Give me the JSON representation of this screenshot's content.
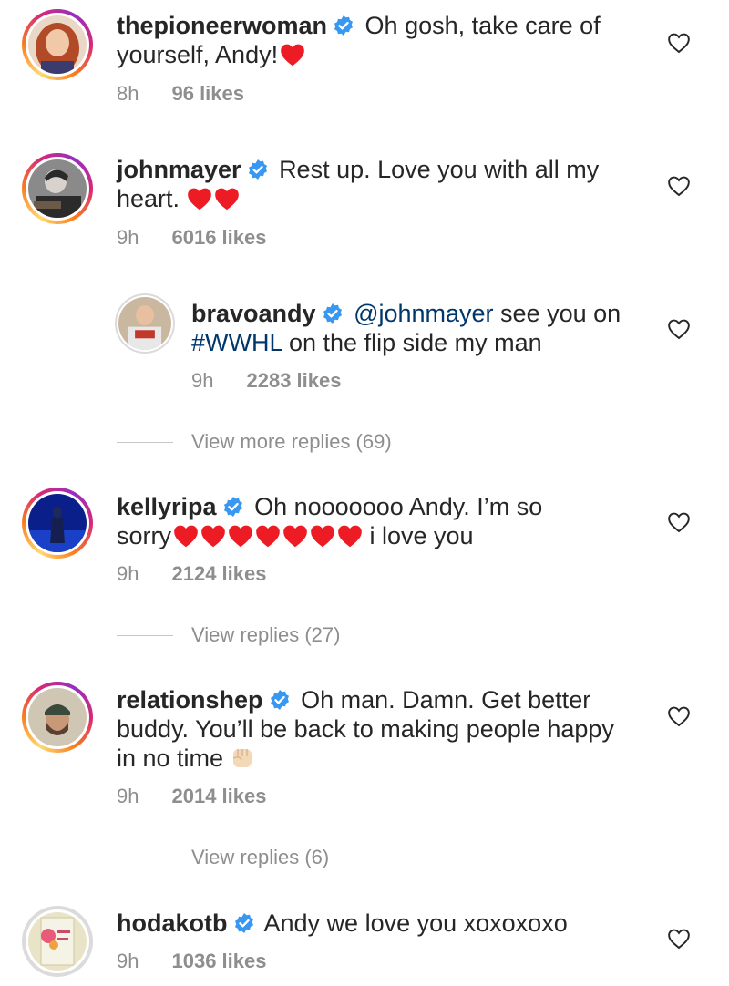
{
  "colors": {
    "verified": "#3897f0",
    "heart": "#ed1c24",
    "muted": "#8e8e8e",
    "mention": "#00376b"
  },
  "comments": [
    {
      "username": "thepioneerwoman",
      "line1": "Oh gosh, take care of",
      "line2": "yourself, Andy!",
      "time": "8h",
      "likes": "96 likes"
    },
    {
      "username": "johnmayer",
      "line1": "Rest up. Love you with all my",
      "line2": "heart.",
      "time": "9h",
      "likes": "6016 likes"
    },
    {
      "username": "bravoandy",
      "mention": "@johnmayer",
      "line1": " see you on",
      "line2_tag": "#WWHL",
      "line2": " on the flip side my man",
      "time": "9h",
      "likes": "2283 likes"
    },
    {
      "username": "kellyripa",
      "line1": "Oh nooooooo Andy. I’m so",
      "line2": "sorry",
      "line2_end": " i love you",
      "time": "9h",
      "likes": "2124 likes"
    },
    {
      "username": "relationshep",
      "line1": "Oh man. Damn. Get better",
      "line2": "buddy. You’ll be back to making people happy",
      "line3": "in no time",
      "time": "9h",
      "likes": "2014 likes"
    },
    {
      "username": "hodakotb",
      "line1": "Andy we love you xoxoxoxo",
      "time": "9h",
      "likes": "1036 likes"
    }
  ],
  "view_more": [
    "View more replies (69)",
    "View replies (27)",
    "View replies (6)"
  ]
}
